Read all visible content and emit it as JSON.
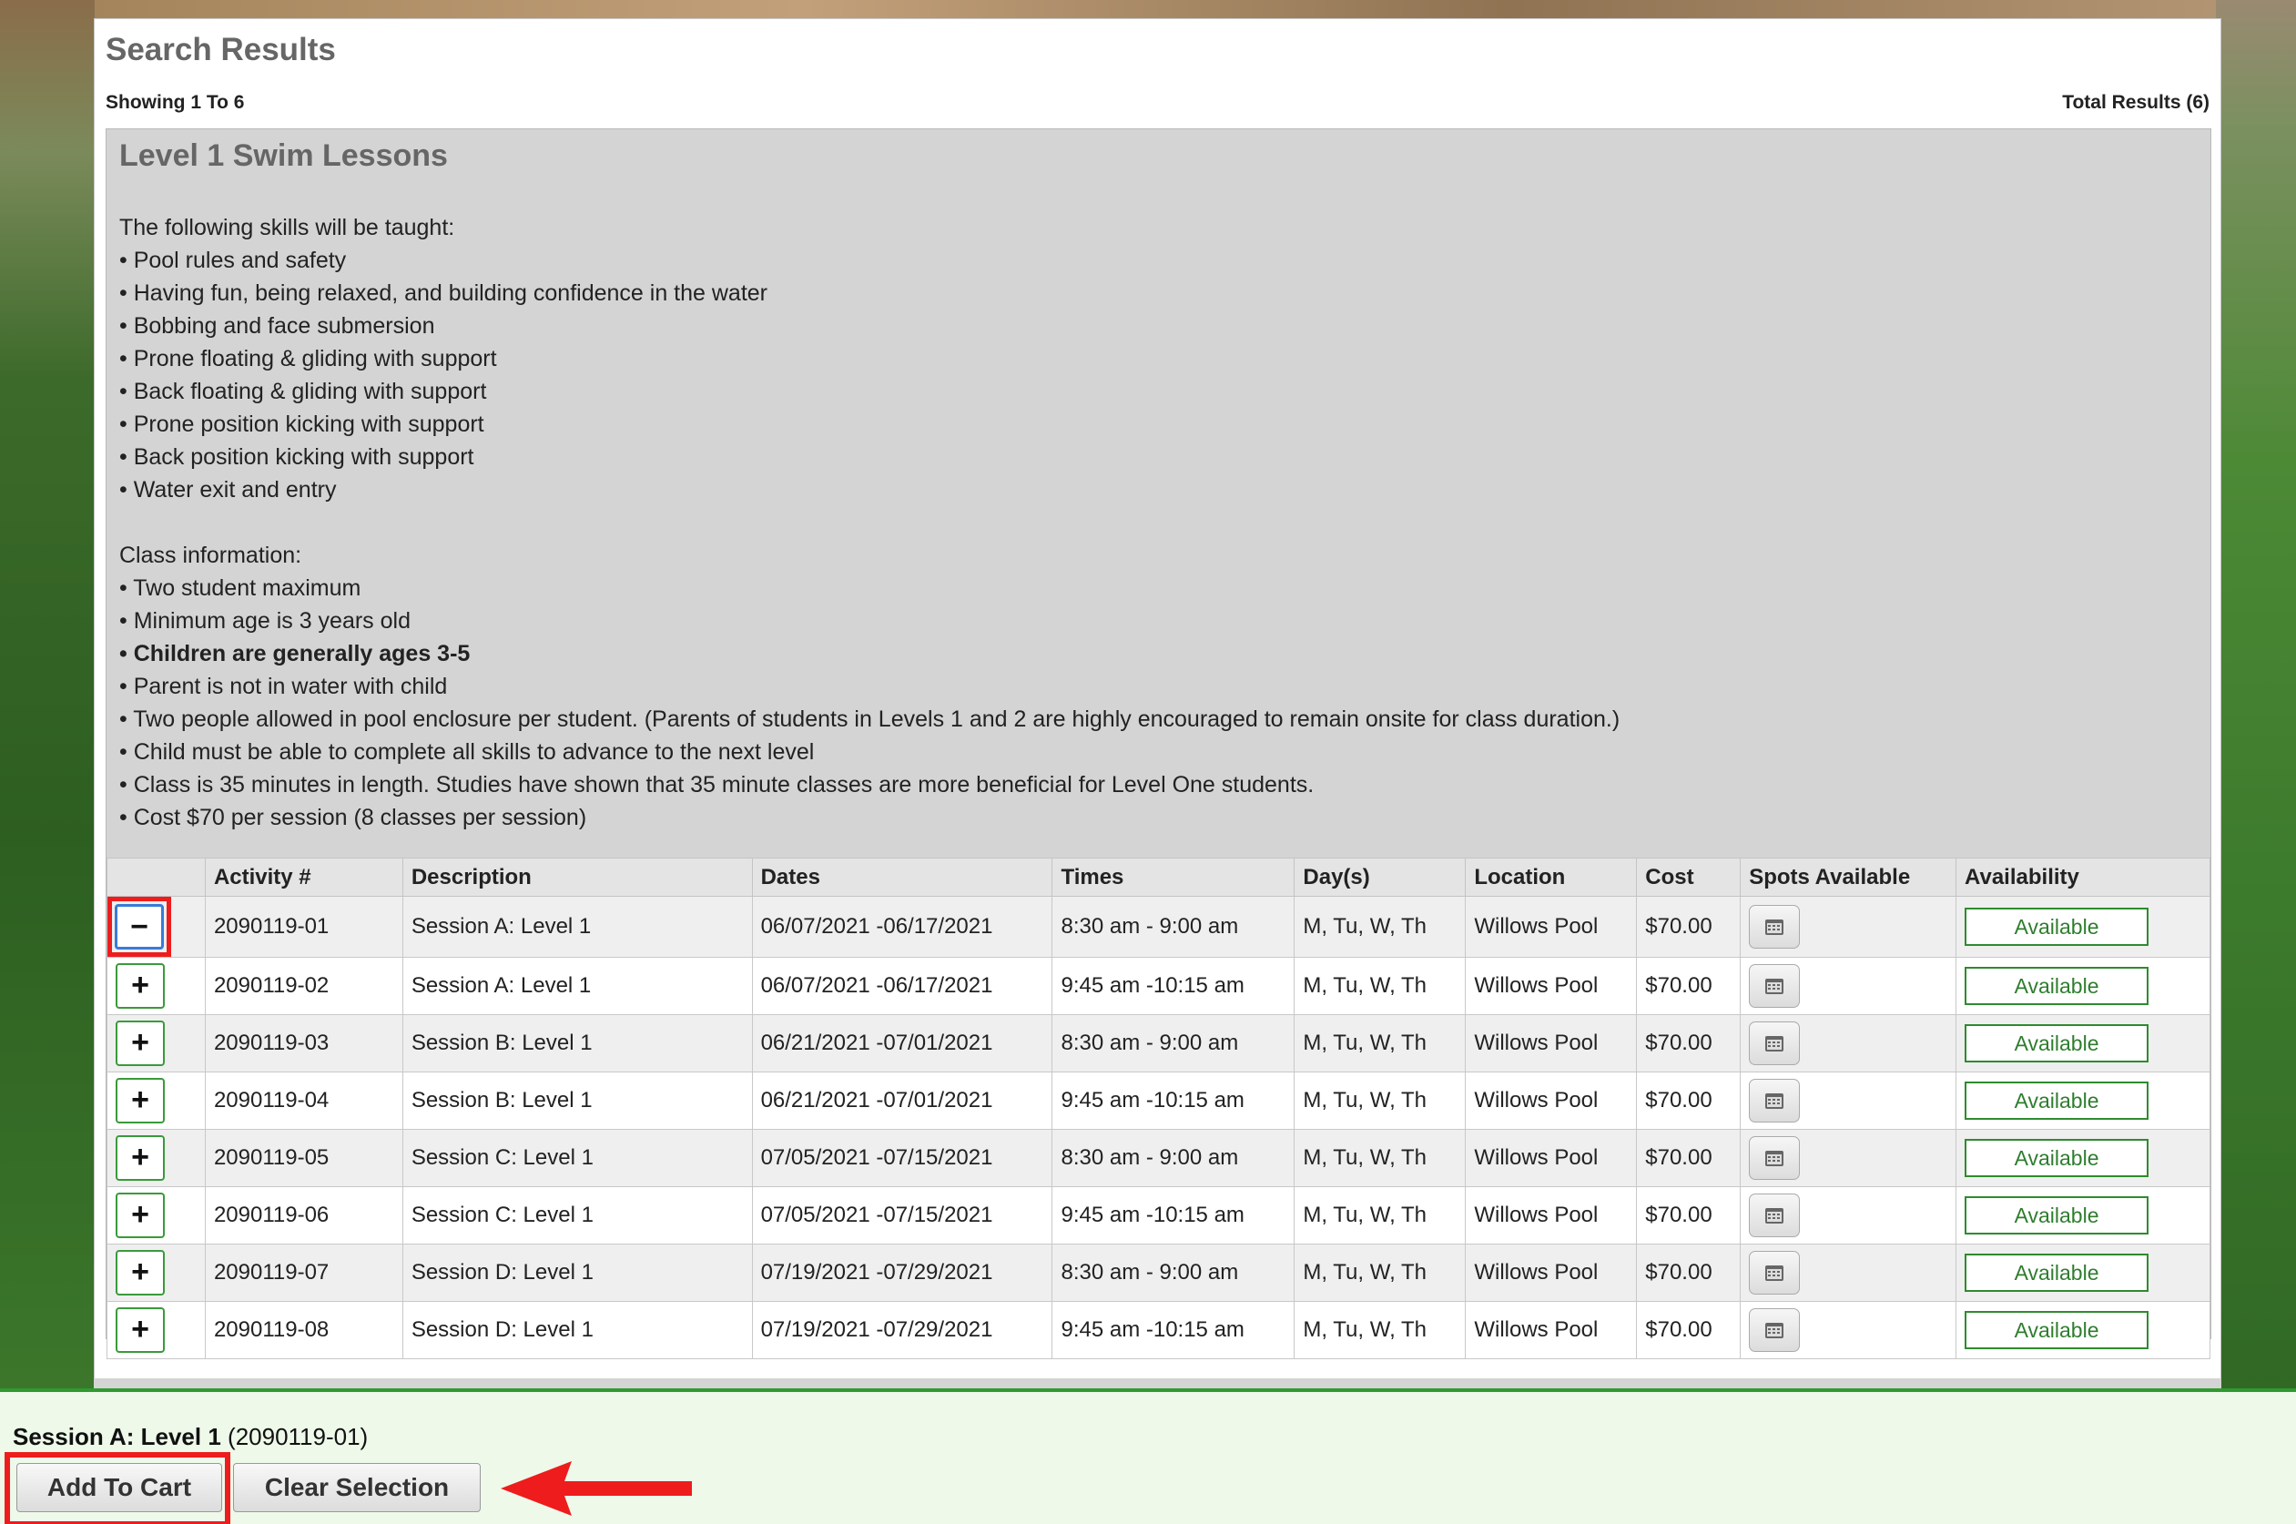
{
  "panel": {
    "title": "Search Results",
    "showing": "Showing 1 To 6",
    "total": "Total Results (6)"
  },
  "activity": {
    "title": "Level 1 Swim Lessons",
    "skills_intro": "The following skills will be taught:",
    "skills": [
      "• Pool rules and safety",
      "• Having fun, being relaxed, and building confidence in the water",
      "• Bobbing and face submersion",
      "• Prone floating & gliding with support",
      "• Back floating & gliding with support",
      "• Prone position kicking with support",
      "• Back position kicking with support",
      "• Water exit and entry"
    ],
    "class_intro": "Class information:",
    "class_info": [
      "• Two student maximum",
      "• Minimum age is 3 years old",
      "• Children are generally ages 3-5",
      "• Parent is not in water with child",
      "• Two people allowed in pool enclosure per student. (Parents of students in Levels 1 and 2 are highly encouraged to remain onsite for class duration.)",
      "• Child must be able to complete all skills to advance to the next level",
      "• Class is 35 minutes in length. Studies have shown that 35 minute classes are more beneficial for Level One students.",
      "• Cost $70 per session (8 classes per session)"
    ]
  },
  "table": {
    "headers": [
      "",
      "Activity #",
      "Description",
      "Dates",
      "Times",
      "Day(s)",
      "Location",
      "Cost",
      "Spots Available",
      "Availability"
    ],
    "rows": [
      {
        "symbol": "−",
        "activity": "2090119-01",
        "description": "Session A: Level 1",
        "dates": "06/07/2021 -06/17/2021",
        "times": "8:30 am - 9:00 am",
        "days": "M, Tu, W, Th",
        "location": "Willows Pool",
        "cost": "$70.00",
        "availability": "Available"
      },
      {
        "symbol": "+",
        "activity": "2090119-02",
        "description": "Session A: Level 1",
        "dates": "06/07/2021 -06/17/2021",
        "times": "9:45 am -10:15 am",
        "days": "M, Tu, W, Th",
        "location": "Willows Pool",
        "cost": "$70.00",
        "availability": "Available"
      },
      {
        "symbol": "+",
        "activity": "2090119-03",
        "description": "Session B: Level 1",
        "dates": "06/21/2021 -07/01/2021",
        "times": "8:30 am - 9:00 am",
        "days": "M, Tu, W, Th",
        "location": "Willows Pool",
        "cost": "$70.00",
        "availability": "Available"
      },
      {
        "symbol": "+",
        "activity": "2090119-04",
        "description": "Session B: Level 1",
        "dates": "06/21/2021 -07/01/2021",
        "times": "9:45 am -10:15 am",
        "days": "M, Tu, W, Th",
        "location": "Willows Pool",
        "cost": "$70.00",
        "availability": "Available"
      },
      {
        "symbol": "+",
        "activity": "2090119-05",
        "description": "Session C: Level 1",
        "dates": "07/05/2021 -07/15/2021",
        "times": "8:30 am - 9:00 am",
        "days": "M, Tu, W, Th",
        "location": "Willows Pool",
        "cost": "$70.00",
        "availability": "Available"
      },
      {
        "symbol": "+",
        "activity": "2090119-06",
        "description": "Session C: Level 1",
        "dates": "07/05/2021 -07/15/2021",
        "times": "9:45 am -10:15 am",
        "days": "M, Tu, W, Th",
        "location": "Willows Pool",
        "cost": "$70.00",
        "availability": "Available"
      },
      {
        "symbol": "+",
        "activity": "2090119-07",
        "description": "Session D: Level 1",
        "dates": "07/19/2021 -07/29/2021",
        "times": "8:30 am - 9:00 am",
        "days": "M, Tu, W, Th",
        "location": "Willows Pool",
        "cost": "$70.00",
        "availability": "Available"
      },
      {
        "symbol": "+",
        "activity": "2090119-08",
        "description": "Session D: Level 1",
        "dates": "07/19/2021 -07/29/2021",
        "times": "9:45 am -10:15 am",
        "days": "M, Tu, W, Th",
        "location": "Willows Pool",
        "cost": "$70.00",
        "availability": "Available"
      }
    ]
  },
  "selection": {
    "name": "Session A: Level 1",
    "code": "(2090119-01)",
    "add_label": "Add To Cart",
    "clear_label": "Clear Selection"
  },
  "icons": {
    "calendar": "calendar-icon",
    "arrow": "red-arrow-icon"
  },
  "colors": {
    "highlight": "#ee1c1c",
    "available": "#2e8b2e",
    "selection_bar": "#eef9ea"
  }
}
